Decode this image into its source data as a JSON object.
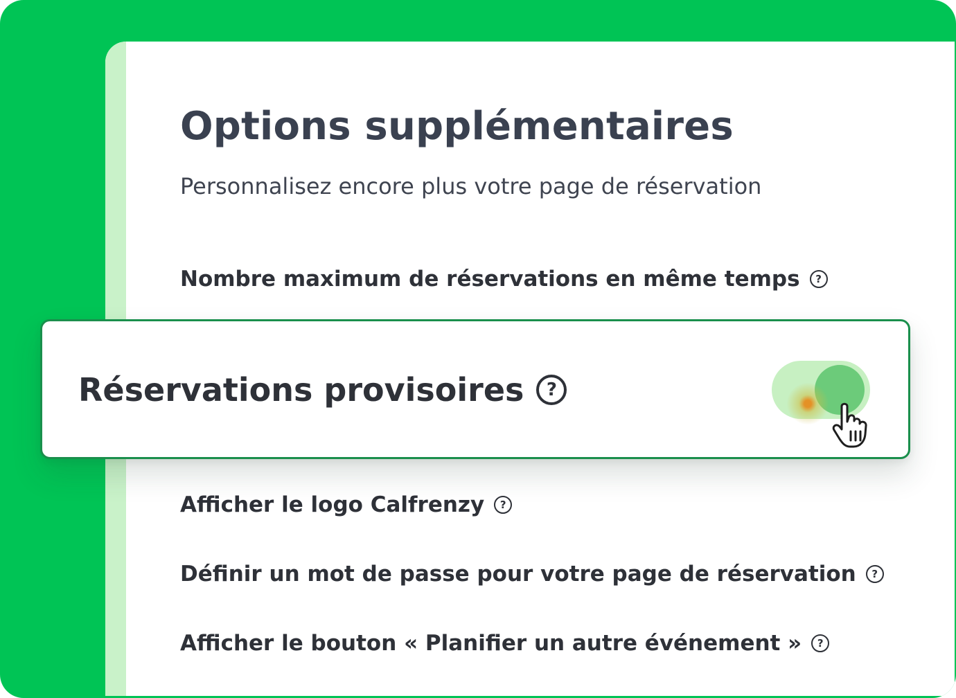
{
  "page": {
    "title": "Options supplémentaires",
    "subtitle": "Personnalisez encore plus votre page de réservation"
  },
  "options": [
    {
      "label": "Nombre maximum de réservations en même temps",
      "help_icon": "question-circle-icon"
    },
    {
      "label": "Réservations provisoires",
      "help_icon": "question-circle-icon",
      "highlighted": true,
      "toggle_on": true
    },
    {
      "label": "Afficher le logo Calfrenzy",
      "help_icon": "question-circle-icon"
    },
    {
      "label": "Définir un mot de passe pour votre page de réservation",
      "help_icon": "question-circle-icon"
    },
    {
      "label": "Afficher le bouton « Planifier un autre événement »",
      "help_icon": "question-circle-icon"
    }
  ],
  "colors": {
    "brand_green": "#00c455",
    "panel_accent": "#c9f2c9",
    "card_border": "#1a8f4c",
    "toggle_track": "#c7f0c2",
    "toggle_knob": "#6ccb7a",
    "text_dark": "#2e3138"
  },
  "cursor": {
    "icon": "hand-pointer-cursor-icon"
  }
}
